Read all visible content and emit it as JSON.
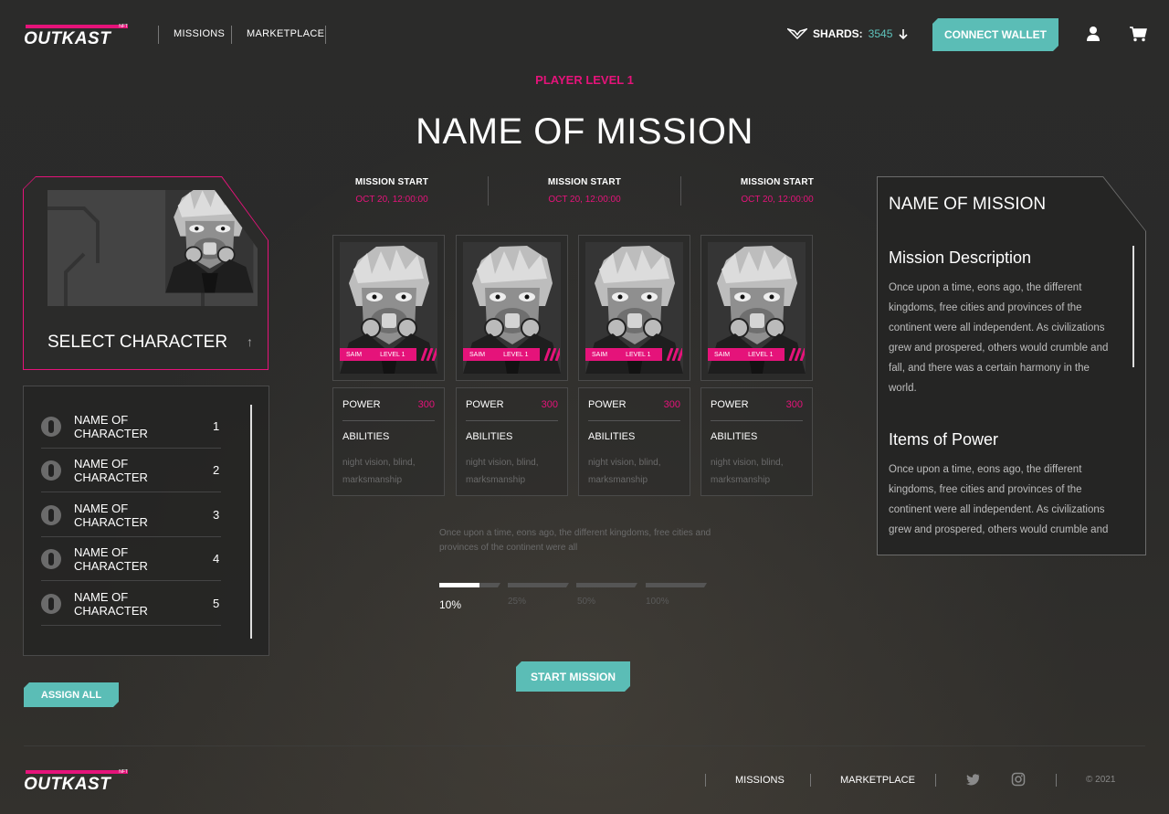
{
  "header": {
    "logo": "OUTKAST",
    "logo_badge": "NFT",
    "nav": [
      "MISSIONS",
      "MARKETPLACE"
    ],
    "shards_label": "SHARDS:",
    "shards_value": "3545",
    "connect_label": "CONNECT WALLET",
    "icons": [
      "user-icon",
      "cart-icon",
      "shards-icon",
      "arrow-down-icon"
    ]
  },
  "player_level": "PLAYER LEVEL 1",
  "mission_title": "NAME OF MISSION",
  "select": {
    "label": "SELECT CHARACTER"
  },
  "characters": [
    {
      "name": "NAME OF CHARACTER",
      "num": "1"
    },
    {
      "name": "NAME OF CHARACTER",
      "num": "2"
    },
    {
      "name": "NAME OF CHARACTER",
      "num": "3"
    },
    {
      "name": "NAME OF CHARACTER",
      "num": "4"
    },
    {
      "name": "NAME OF CHARACTER",
      "num": "5"
    }
  ],
  "assign_label": "ASSIGN ALL",
  "mission_starts": [
    {
      "label": "MISSION START",
      "date": "OCT 20, 12:00:00"
    },
    {
      "label": "MISSION START",
      "date": "OCT 20, 12:00:00"
    },
    {
      "label": "MISSION START",
      "date": "OCT 20, 12:00:00"
    }
  ],
  "cards": [
    {
      "name": "SAIM",
      "level": "LEVEL 1",
      "power_label": "POWER",
      "power": "300",
      "abilities_label": "ABILITIES",
      "abilities": "night vision, blind, marksmanship"
    },
    {
      "name": "SAIM",
      "level": "LEVEL 1",
      "power_label": "POWER",
      "power": "300",
      "abilities_label": "ABILITIES",
      "abilities": "night vision, blind, marksmanship"
    },
    {
      "name": "SAIM",
      "level": "LEVEL 1",
      "power_label": "POWER",
      "power": "300",
      "abilities_label": "ABILITIES",
      "abilities": "night vision, blind, marksmanship"
    },
    {
      "name": "SAIM",
      "level": "LEVEL 1",
      "power_label": "POWER",
      "power": "300",
      "abilities_label": "ABILITIES",
      "abilities": "night vision, blind, marksmanship"
    }
  ],
  "blurb": "Once upon a time, eons ago, the different kingdoms, free cities and provinces of the continent were all",
  "progress": {
    "steps": [
      {
        "label": "10%",
        "fill": 0.65
      },
      {
        "label": "25%",
        "fill": 0
      },
      {
        "label": "50%",
        "fill": 0
      },
      {
        "label": "100%",
        "fill": 0
      }
    ],
    "active_index": 0
  },
  "start_label": "START MISSION",
  "description": {
    "title": "NAME OF MISSION",
    "section1_heading": "Mission Description",
    "section1_text": "Once upon a time, eons ago, the different kingdoms, free cities and provinces of the continent were all independent. As civilizations grew and prospered, others would crumble and fall, and there was a certain harmony in the world.",
    "section2_heading": "Items of Power",
    "section2_text": "Once upon a time, eons ago, the different kingdoms, free cities and provinces of the continent were all independent. As civilizations grew and prospered, others would crumble and"
  },
  "footer": {
    "logo": "OUTKAST",
    "logo_badge": "NFT",
    "nav": [
      "MISSIONS",
      "MARKETPLACE"
    ],
    "copyright": "© 2021",
    "icons": [
      "twitter-icon",
      "instagram-icon"
    ]
  },
  "colors": {
    "accent": "#e5137a",
    "teal": "#5bbdb6",
    "bg": "#2a2a28"
  }
}
